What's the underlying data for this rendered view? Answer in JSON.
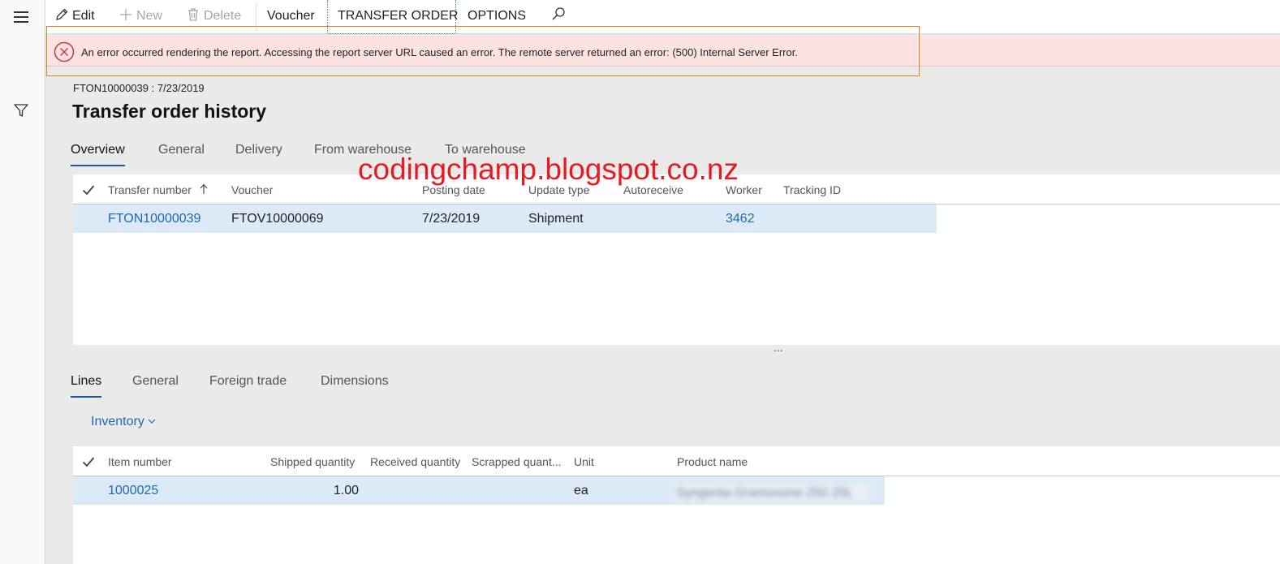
{
  "toolbar": {
    "edit": "Edit",
    "new": "New",
    "delete": "Delete",
    "voucher": "Voucher",
    "transfer_order": "TRANSFER ORDER",
    "options": "OPTIONS"
  },
  "error": {
    "message": "An error occurred rendering the report. Accessing the report server URL caused an error. The remote server returned an error: (500) Internal Server Error."
  },
  "caption": "FTON10000039 : 7/23/2019",
  "title": "Transfer order history",
  "header_tabs": [
    "Overview",
    "General",
    "Delivery",
    "From warehouse",
    "To warehouse"
  ],
  "watermark": "codingchamp.blogspot.co.nz",
  "history_grid": {
    "columns": [
      "Transfer number",
      "Voucher",
      "Posting date",
      "Update type",
      "Autoreceive",
      "Worker",
      "Tracking ID"
    ],
    "rows": [
      {
        "transfer_number": "FTON10000039",
        "voucher": "FTOV10000069",
        "posting_date": "7/23/2019",
        "update_type": "Shipment",
        "autoreceive": "",
        "worker": "3462",
        "tracking_id": ""
      }
    ]
  },
  "splitter": "...",
  "lines_tabs": [
    "Lines",
    "General",
    "Foreign trade",
    "Dimensions"
  ],
  "inventory_menu": "Inventory",
  "lines_grid": {
    "columns": [
      "Item number",
      "Shipped quantity",
      "Received quantity",
      "Scrapped quant...",
      "Unit",
      "Product name"
    ],
    "rows": [
      {
        "item_number": "1000025",
        "shipped_quantity": "1.00",
        "received_quantity": "",
        "scrapped_quantity": "",
        "unit": "ea",
        "product_name": "Syngenta Gramoxone 250 20L"
      }
    ]
  },
  "colors": {
    "accent": "#1e5a9b",
    "link": "#1d6ab0",
    "error_bg": "#fde2e2",
    "error_icon": "#d13438",
    "highlight_outline": "#e67e22",
    "watermark": "#e51b24",
    "selected_row": "#dce9f6"
  }
}
